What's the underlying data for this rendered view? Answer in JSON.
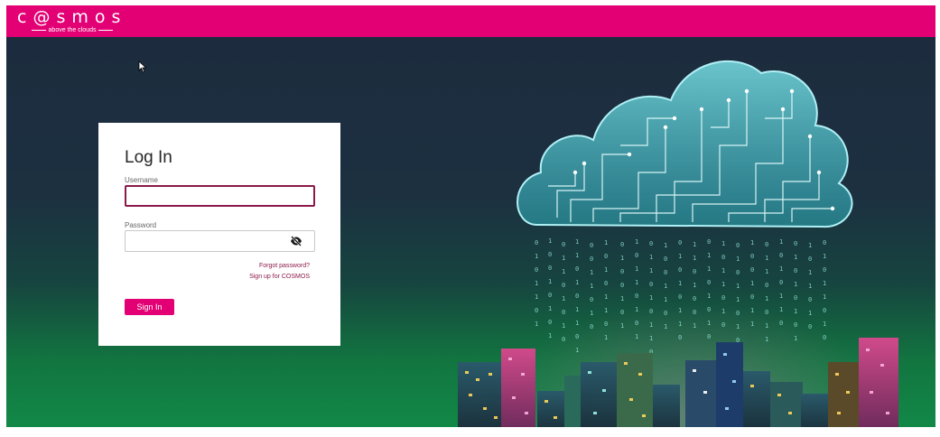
{
  "header": {
    "logo_text": "c@smos",
    "logo_tagline": "above the clouds",
    "brand_color": "#e20074"
  },
  "login": {
    "title": "Log In",
    "username_label": "Username",
    "username_value": "",
    "password_label": "Password",
    "password_value": "",
    "password_toggle_icon": "eye-slash-icon",
    "forgot_password": "Forgot password?",
    "signup": "Sign up for COSMOS",
    "signin_button": "Sign In"
  },
  "hero": {
    "illustration": "cloud-circuit-city-illustration"
  },
  "cursor": {
    "icon": "mouse-pointer-icon"
  }
}
